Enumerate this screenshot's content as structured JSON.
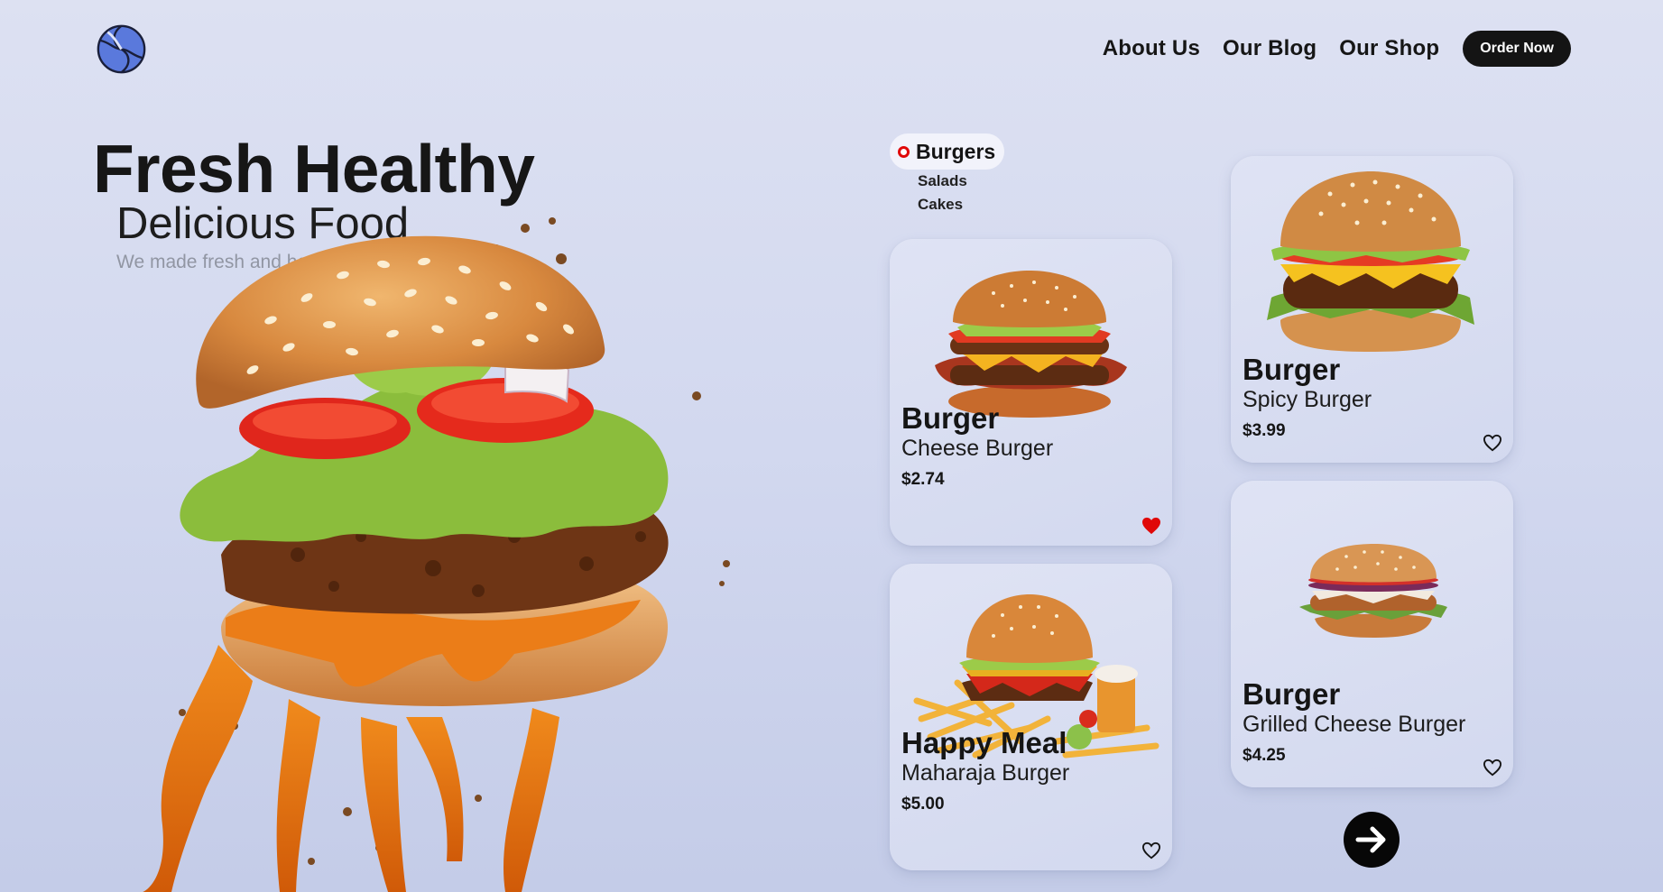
{
  "header": {
    "logo_icon": "swirl-logo-icon",
    "nav": [
      "About Us",
      "Our Blog",
      "Our Shop"
    ],
    "order_label": "Order Now"
  },
  "hero": {
    "title": "Fresh Healthy",
    "subtitle": "Delicious Food",
    "tagline": "We made fresh and healthy foods"
  },
  "categories": {
    "active": "Burgers",
    "items": [
      "Salads",
      "Cakes"
    ]
  },
  "cards": [
    {
      "title": "Burger",
      "name": "Cheese Burger",
      "price": "$2.74",
      "favorite": true
    },
    {
      "title": "Happy Meal",
      "name": "Maharaja Burger",
      "price": "$5.00",
      "favorite": false
    },
    {
      "title": "Burger",
      "name": "Spicy Burger",
      "price": "$3.99",
      "favorite": false
    },
    {
      "title": "Burger",
      "name": "Grilled Cheese Burger",
      "price": "$4.25",
      "favorite": false
    }
  ],
  "colors": {
    "accent": "#e00808",
    "dark": "#141414",
    "background": "#d6dcf0"
  },
  "icons": {
    "heart": "heart-icon",
    "next": "arrow-right-icon"
  }
}
